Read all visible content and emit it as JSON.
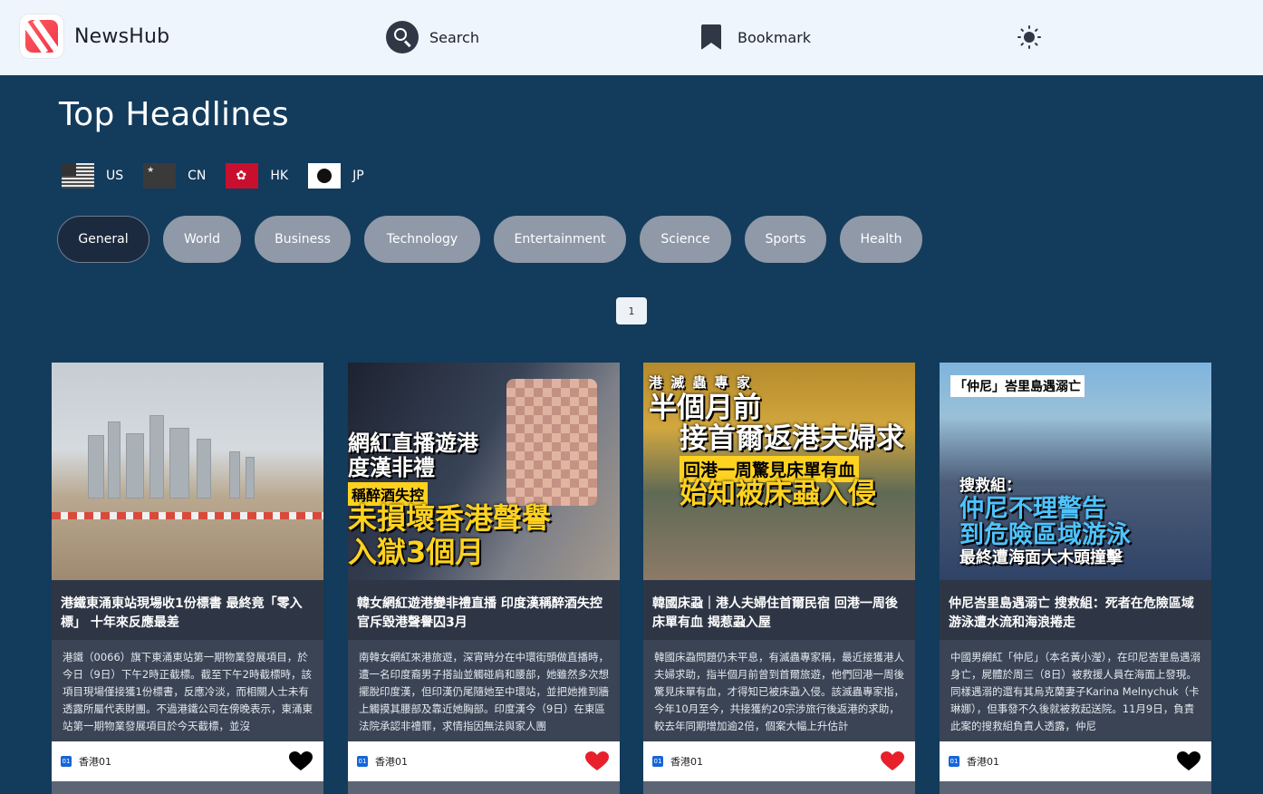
{
  "header": {
    "app_name": "NewsHub",
    "search_label": "Search",
    "bookmark_label": "Bookmark"
  },
  "page": {
    "title": "Top Headlines",
    "countries": [
      {
        "code": "US"
      },
      {
        "code": "CN"
      },
      {
        "code": "HK"
      },
      {
        "code": "JP"
      }
    ],
    "categories": [
      {
        "label": "General",
        "active": true
      },
      {
        "label": "World"
      },
      {
        "label": "Business"
      },
      {
        "label": "Technology"
      },
      {
        "label": "Entertainment"
      },
      {
        "label": "Science"
      },
      {
        "label": "Sports"
      },
      {
        "label": "Health"
      }
    ],
    "pagination": {
      "current": "1"
    }
  },
  "articles": [
    {
      "title": "港鐵東涌東站現場收1份標書 最終竟「零入標」 十年來反應最差",
      "description": "港鐵（0066）旗下東涌東站第一期物業發展項目，於今日（9日）下午2時正截標。截至下午2時截標時，該項目現場僅接獲1份標書，反應冷淡，而相關人士未有透露所屬代表財團。不過港鐵公司在傍晚表示，東涌東站第一期物業發展項目於今天截標，並沒",
      "source": "香港01",
      "bookmarked": false,
      "image_text": []
    },
    {
      "title": "韓女網紅遊港變非禮直播 印度漢稱醉酒失控 官斥毀港聲譽囚3月",
      "description": "南韓女網紅來港旅遊，深宵時分在中環街頭做直播時，遭一名印度裔男子搭訕並觸碰肩和腰部，她雖然多次想擺脫印度漢，但印漢仍尾隨她至中環站，並把她推到牆上觸摸其腰部及靠近她胸部。印度漢今（9日）在東區法院承認非禮罪，求情指因無法與家人團",
      "source": "香港01",
      "bookmarked": true,
      "image_text": [
        "網紅直播遊港",
        "度漢非禮",
        "稱醉酒失控",
        "未損壞香港聲譽",
        "入獄3個月"
      ]
    },
    {
      "title": "韓國床蝨｜港人夫婦住首爾民宿 回港一周後床單有血 揭惹蝨入屋",
      "description": "韓國床蝨問題仍未平息，有滅蟲專家稱，最近接獲港人夫婦求助，指半個月前曾到首爾旅遊，他們回港一周後驚見床單有血，才得知已被床蝨入侵。該滅蟲專家指，今年10月至今，共接獲約20宗涉旅行後返港的求助，較去年同期增加逾2倍，個案大幅上升估計",
      "source": "香港01",
      "bookmarked": true,
      "image_text": [
        "港 滅 蟲 專 家",
        "半個月前",
        "接首爾返港夫婦求",
        "回港一周驚見床單有血",
        "始知被床蝨入侵"
      ]
    },
    {
      "title": "仲尼峇里島遇溺亡 搜救組：死者在危險區域游泳遭水流和海浪捲走",
      "description": "中國男網紅「仲尼」（本名黃小瀅），在印尼峇里島遇溺身亡，屍體於周三（8日）被救援人員在海面上發現。同樣遇溺的還有其烏克蘭妻子Karina Melnychuk（卡琳娜），但事發不久後就被救起送院。11月9日，負責此案的搜救組負責人透露，仲尼",
      "source": "香港01",
      "bookmarked": false,
      "image_text": [
        "「仲尼」峇里島遇溺亡",
        "搜救組：",
        "仲尼不理警告",
        "到危險區域游泳",
        "最終遭海面大木頭撞擊"
      ]
    }
  ],
  "colors": {
    "page_bg": "#133b5c",
    "header_bg": "#eef5fc",
    "chip_bg": "#8f99a8",
    "chip_active_bg": "#1b2a3e",
    "heart_red": "#e8202b"
  }
}
